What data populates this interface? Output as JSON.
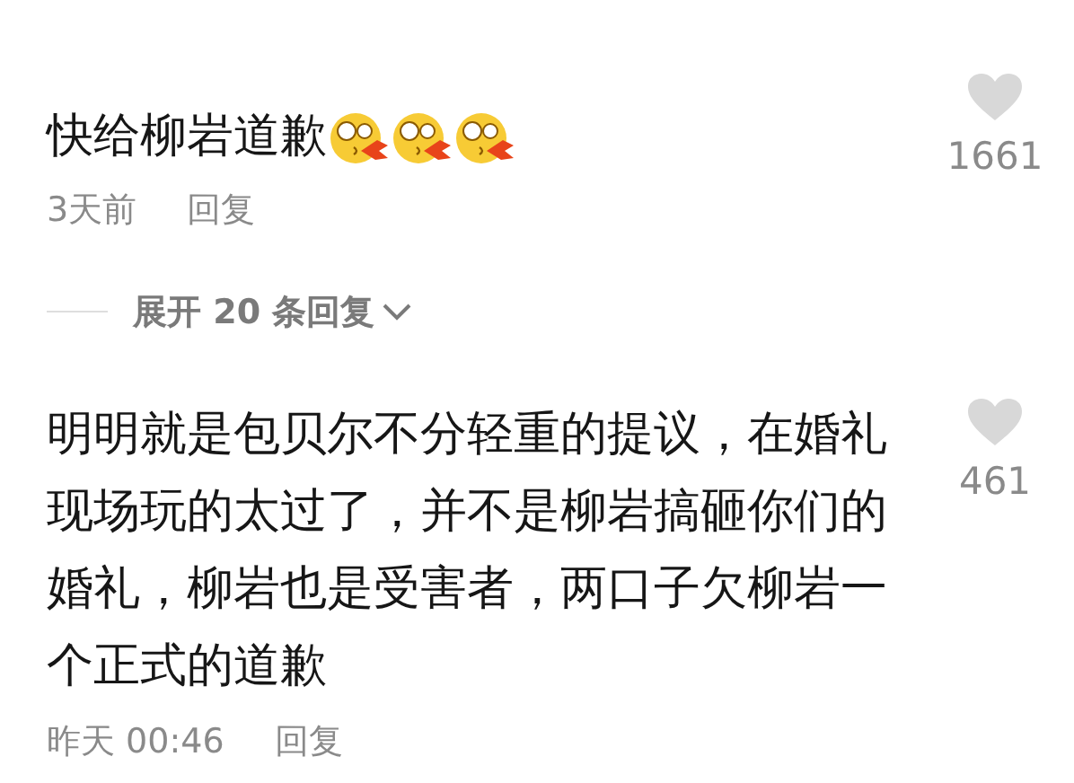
{
  "comments": [
    {
      "text": "快给柳岩道歉",
      "emojis": [
        {
          "kind": "blowing"
        },
        {
          "kind": "blowing"
        },
        {
          "kind": "blowing"
        }
      ],
      "time": "3天前",
      "reply": "回复",
      "liked": false,
      "likes": "1661",
      "expand": "展开 20 条回复"
    },
    {
      "text": "明明就是包贝尔不分轻重的提议，在婚礼现场玩的太过了，并不是柳岩搞砸你们的婚礼，柳岩也是受害者，两口子欠柳岩一个正式的道歉",
      "time": "昨天 00:46",
      "reply": "回复",
      "liked": false,
      "likes": "461"
    }
  ]
}
